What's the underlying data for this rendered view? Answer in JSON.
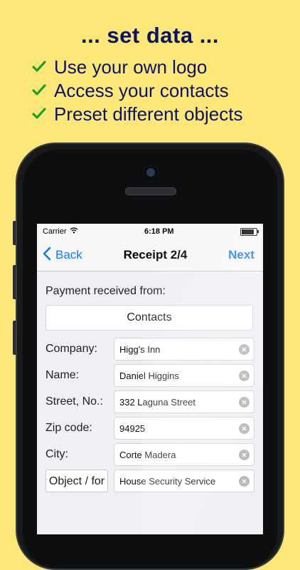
{
  "promo": {
    "title": "... set data ...",
    "features": [
      "Use your own logo",
      "Access your contacts",
      "Preset different objects"
    ],
    "check_color": "#1fa02b",
    "text_color": "#0a1460",
    "background": "#fde779"
  },
  "status_bar": {
    "carrier": "Carrier",
    "time": "6:18 PM",
    "icons": [
      "wifi-icon",
      "battery-icon"
    ]
  },
  "nav": {
    "back_label": "Back",
    "title": "Receipt 2/4",
    "next_label": "Next",
    "accent": "#1a78e8"
  },
  "form": {
    "payment_label": "Payment received from:",
    "contacts_button": "Contacts",
    "fields": [
      {
        "label": "Company:",
        "value": "Higg's Inn"
      },
      {
        "label": "Name:",
        "value": "Daniel Higgins"
      },
      {
        "label": "Street, No.:",
        "value": "332 Laguna Street"
      },
      {
        "label": "Zip code:",
        "value": "94925"
      },
      {
        "label": "City:",
        "value": "Corte Madera"
      },
      {
        "label": "Object / for",
        "value": "House Security Service"
      }
    ]
  }
}
